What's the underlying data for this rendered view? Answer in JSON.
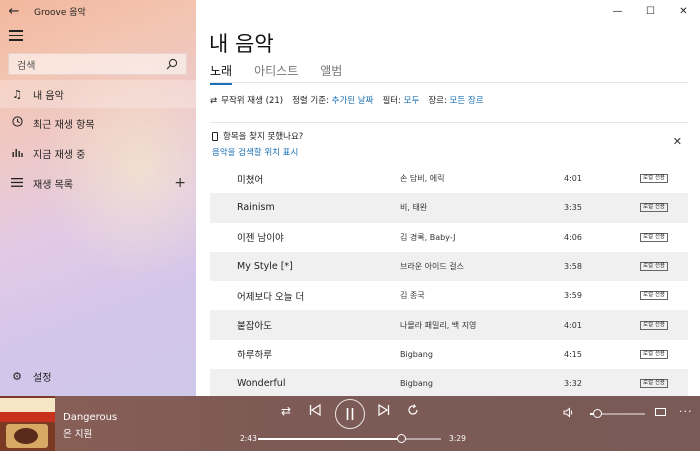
{
  "app": {
    "title": "Groove 음악"
  },
  "sidebar": {
    "search_placeholder": "검색",
    "items": [
      {
        "label": "내 음악",
        "icon": "music-note-icon"
      },
      {
        "label": "최근 재생 항목",
        "icon": "clock-icon"
      },
      {
        "label": "지금 재생 중",
        "icon": "equalizer-icon"
      },
      {
        "label": "재생 목록",
        "icon": "playlist-icon"
      }
    ],
    "settings_label": "설정"
  },
  "main": {
    "title": "내 음악",
    "tabs": [
      {
        "label": "노래",
        "active": true
      },
      {
        "label": "아티스트",
        "active": false
      },
      {
        "label": "앨범",
        "active": false
      }
    ],
    "filters": {
      "shuffle_label": "무작위 재생 (21)",
      "sort_prefix": "정렬 기준:",
      "sort_value": "추가된 날짜",
      "filter_prefix": "필터:",
      "filter_value": "모두",
      "genre_prefix": "장르:",
      "genre_value": "모든 장르"
    },
    "notice": {
      "question": "항목을 찾지 못했나요?",
      "link": "음악을 검색할 위치 표시"
    },
    "songs": [
      {
        "title": "미쳤어",
        "artist": "손 담비, 에릭",
        "duration": "4:01",
        "badge": "로컬 전용"
      },
      {
        "title": "Rainism",
        "artist": "비, 태완",
        "duration": "3:35",
        "badge": "로컬 전용"
      },
      {
        "title": "이젠 남이야",
        "artist": "김 경록, Baby-J",
        "duration": "4:06",
        "badge": "로컬 전용"
      },
      {
        "title": "My Style [*]",
        "artist": "브라운 아이드 걸스",
        "duration": "3:58",
        "badge": "로컬 전용"
      },
      {
        "title": "어제보다 오늘 더",
        "artist": "김 종국",
        "duration": "3:59",
        "badge": "로컬 전용"
      },
      {
        "title": "붙잡아도",
        "artist": "나몰라 패밀리, 백 지영",
        "duration": "4:01",
        "badge": "로컬 전용"
      },
      {
        "title": "하루하루",
        "artist": "Bigbang",
        "duration": "4:15",
        "badge": "로컬 전용"
      },
      {
        "title": "Wonderful",
        "artist": "Bigbang",
        "duration": "3:32",
        "badge": "로컬 전용"
      }
    ]
  },
  "player": {
    "track_title": "Dangerous",
    "track_artist": "은 지원",
    "elapsed": "2:43",
    "total": "3:29",
    "progress_fraction": 0.78,
    "volume_fraction": 0.12,
    "accent": "#1a6fb5"
  }
}
